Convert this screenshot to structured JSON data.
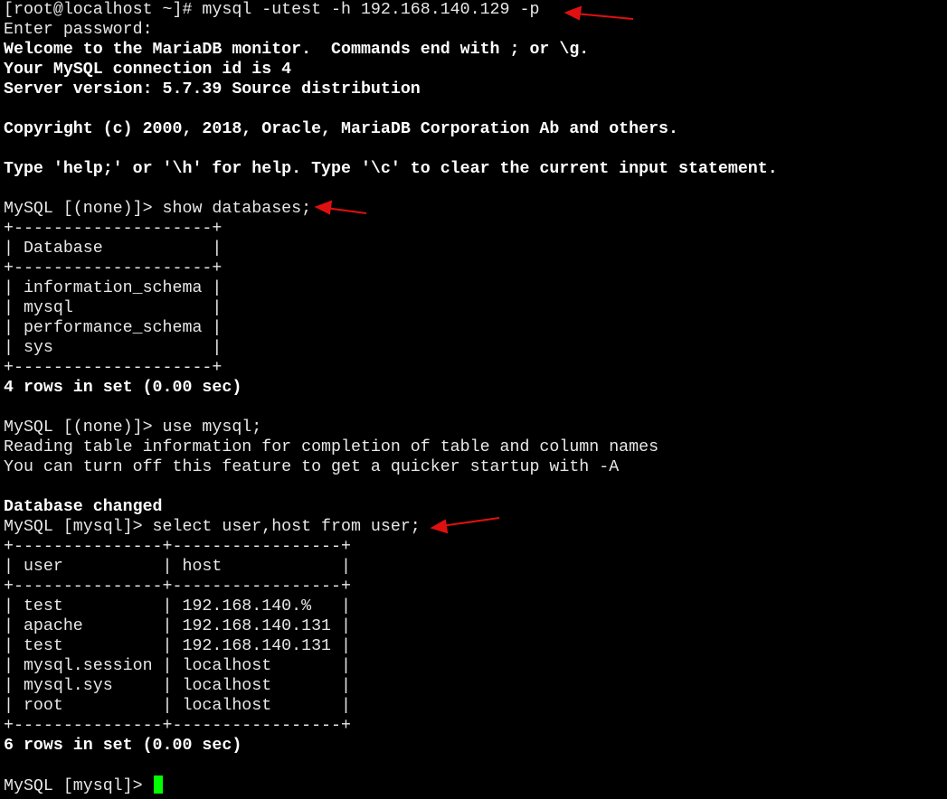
{
  "terminal": {
    "lines": [
      {
        "text": "[root@localhost ~]# mysql -utest -h 192.168.140.129 -p",
        "bold": false
      },
      {
        "text": "Enter password:",
        "bold": false
      },
      {
        "text": "Welcome to the MariaDB monitor.  Commands end with ; or \\g.",
        "bold": true
      },
      {
        "text": "Your MySQL connection id is 4",
        "bold": true
      },
      {
        "text": "Server version: 5.7.39 Source distribution",
        "bold": true
      },
      {
        "text": "",
        "bold": false
      },
      {
        "text": "Copyright (c) 2000, 2018, Oracle, MariaDB Corporation Ab and others.",
        "bold": true
      },
      {
        "text": "",
        "bold": false
      },
      {
        "text": "Type 'help;' or '\\h' for help. Type '\\c' to clear the current input statement.",
        "bold": true
      },
      {
        "text": "",
        "bold": false
      },
      {
        "text": "MySQL [(none)]> show databases;",
        "bold": false
      },
      {
        "text": "+--------------------+",
        "bold": false
      },
      {
        "text": "| Database           |",
        "bold": false
      },
      {
        "text": "+--------------------+",
        "bold": false
      },
      {
        "text": "| information_schema |",
        "bold": false
      },
      {
        "text": "| mysql              |",
        "bold": false
      },
      {
        "text": "| performance_schema |",
        "bold": false
      },
      {
        "text": "| sys                |",
        "bold": false
      },
      {
        "text": "+--------------------+",
        "bold": false
      },
      {
        "text": "4 rows in set (0.00 sec)",
        "bold": true
      },
      {
        "text": "",
        "bold": false
      },
      {
        "text": "MySQL [(none)]> use mysql;",
        "bold": false
      },
      {
        "text": "Reading table information for completion of table and column names",
        "bold": false
      },
      {
        "text": "You can turn off this feature to get a quicker startup with -A",
        "bold": false
      },
      {
        "text": "",
        "bold": false
      },
      {
        "text": "Database changed",
        "bold": true
      },
      {
        "text": "MySQL [mysql]> select user,host from user;",
        "bold": false
      },
      {
        "text": "+---------------+-----------------+",
        "bold": false
      },
      {
        "text": "| user          | host            |",
        "bold": false
      },
      {
        "text": "+---------------+-----------------+",
        "bold": false
      },
      {
        "text": "| test          | 192.168.140.%   |",
        "bold": false
      },
      {
        "text": "| apache        | 192.168.140.131 |",
        "bold": false
      },
      {
        "text": "| test          | 192.168.140.131 |",
        "bold": false
      },
      {
        "text": "| mysql.session | localhost       |",
        "bold": false
      },
      {
        "text": "| mysql.sys     | localhost       |",
        "bold": false
      },
      {
        "text": "| root          | localhost       |",
        "bold": false
      },
      {
        "text": "+---------------+-----------------+",
        "bold": false
      },
      {
        "text": "6 rows in set (0.00 sec)",
        "bold": true
      },
      {
        "text": "",
        "bold": false
      },
      {
        "text": "MySQL [mysql]> ",
        "bold": false,
        "cursor": true
      }
    ],
    "colors": {
      "background": "#000000",
      "text": "#e8e8e8",
      "cursor": "#00ff00",
      "annotation_arrow": "#e01010"
    }
  }
}
